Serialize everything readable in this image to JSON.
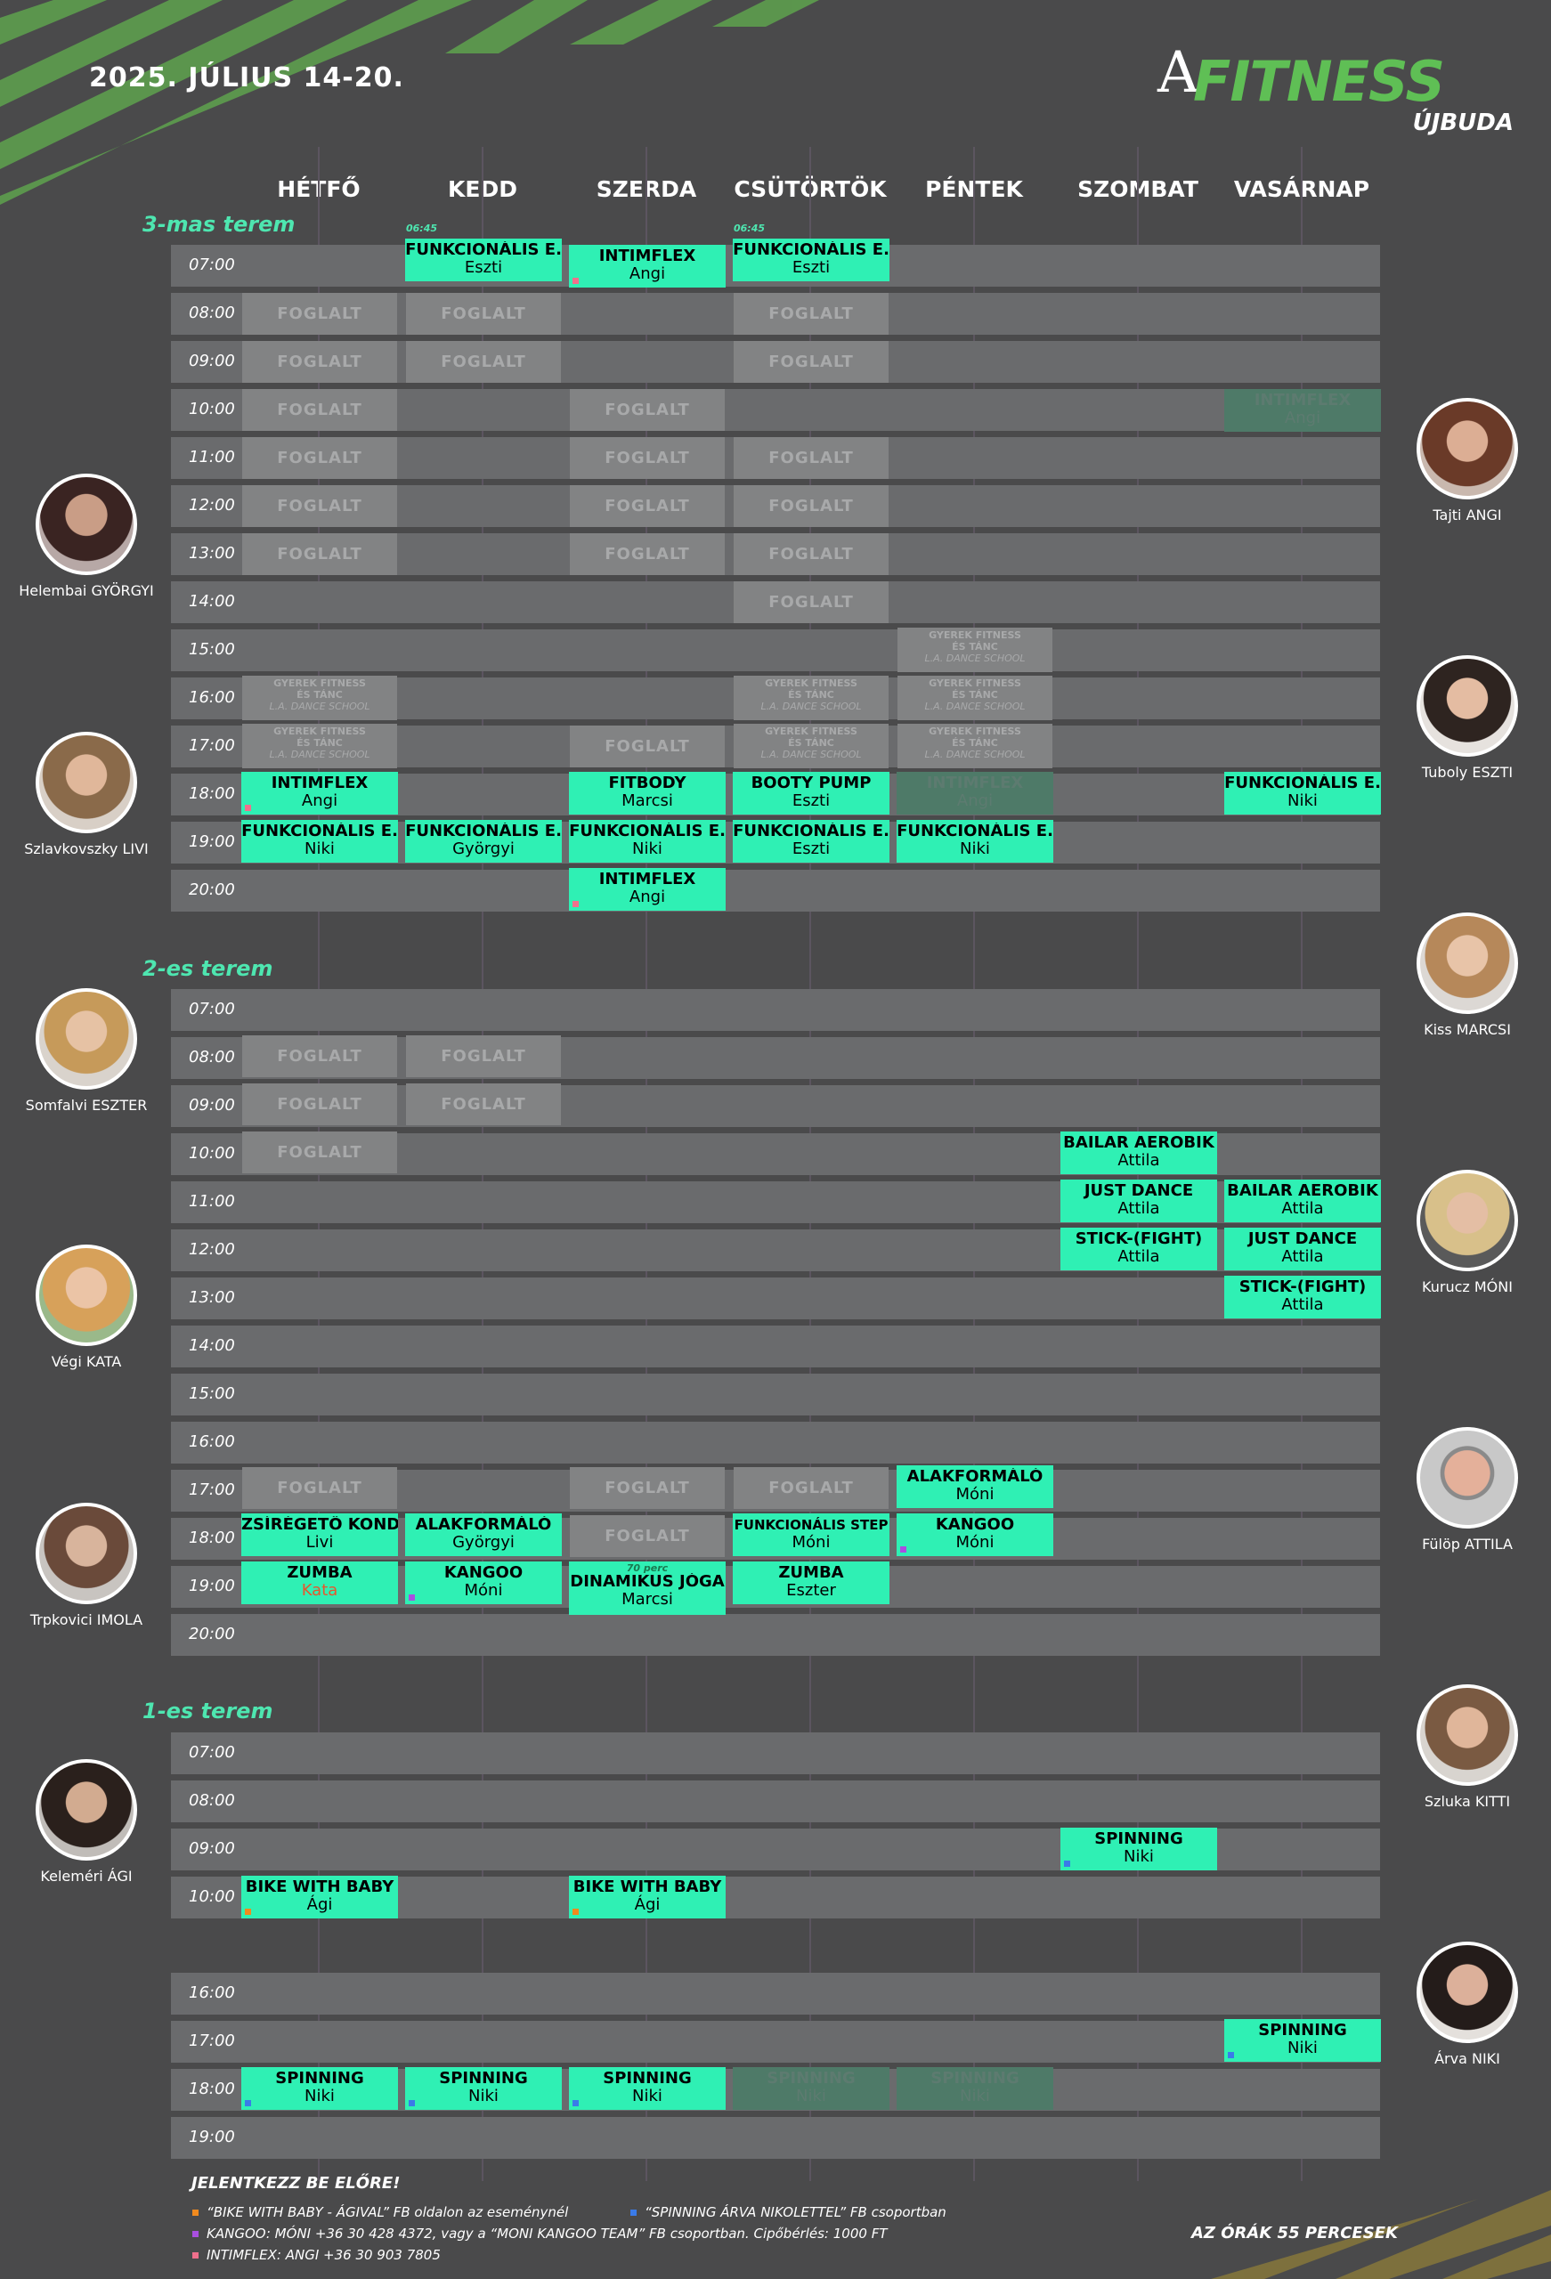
{
  "header": {
    "date": "2025. JÚLIUS 14-20.",
    "logo_a": "A",
    "logo_fitness": "FITNESS",
    "logo_location": "ÚJBUDA"
  },
  "days": [
    "HÉTFŐ",
    "KEDD",
    "SZERDA",
    "CSÜTÖRTÖK",
    "PÉNTEK",
    "SZOMBAT",
    "VASÁRNAP"
  ],
  "sections": [
    {
      "title": "3-mas terem",
      "times": [
        "07:00",
        "08:00",
        "09:00",
        "10:00",
        "11:00",
        "12:00",
        "13:00",
        "14:00",
        "15:00",
        "16:00",
        "17:00",
        "18:00",
        "19:00",
        "20:00"
      ]
    },
    {
      "title": "2-es terem",
      "times": [
        "07:00",
        "08:00",
        "09:00",
        "10:00",
        "11:00",
        "12:00",
        "13:00",
        "14:00",
        "15:00",
        "16:00",
        "17:00",
        "18:00",
        "19:00",
        "20:00"
      ]
    },
    {
      "title": "1-es terem",
      "times_a": [
        "07:00",
        "08:00",
        "09:00",
        "10:00"
      ],
      "times_b": [
        "16:00",
        "17:00",
        "18:00",
        "19:00"
      ]
    }
  ],
  "labels": {
    "foglalt": "FOGLALT",
    "gyerek_1": "GYEREK FITNESS",
    "gyerek_2": "ÉS TÁNC",
    "gyerek_3": "L.A. DANCE SCHOOL",
    "early": "06:45",
    "perc70": "70 perc"
  },
  "classes": {
    "t3_kedd_07": {
      "name": "FUNKCIONÁLIS E.",
      "instructor": "Eszti"
    },
    "t3_szerda_07": {
      "name": "INTIMFLEX",
      "instructor": "Angi"
    },
    "t3_csut_07": {
      "name": "FUNKCIONÁLIS E.",
      "instructor": "Eszti"
    },
    "t3_vas_10": {
      "name": "INTIMFLEX",
      "instructor": "Angi"
    },
    "t3_het_18": {
      "name": "INTIMFLEX",
      "instructor": "Angi"
    },
    "t3_sze_18": {
      "name": "FITBODY",
      "instructor": "Marcsi"
    },
    "t3_csu_18": {
      "name": "BOOTY PUMP",
      "instructor": "Eszti"
    },
    "t3_pen_18": {
      "name": "INTIMFLEX",
      "instructor": "Angi"
    },
    "t3_vas_18": {
      "name": "FUNKCIONÁLIS E.",
      "instructor": "Niki"
    },
    "t3_het_19": {
      "name": "FUNKCIONÁLIS E.",
      "instructor": "Niki"
    },
    "t3_ked_19": {
      "name": "FUNKCIONÁLIS E.",
      "instructor": "Györgyi"
    },
    "t3_sze_19": {
      "name": "FUNKCIONÁLIS E.",
      "instructor": "Niki"
    },
    "t3_csu_19": {
      "name": "FUNKCIONÁLIS E.",
      "instructor": "Eszti"
    },
    "t3_pen_19": {
      "name": "FUNKCIONÁLIS E.",
      "instructor": "Niki"
    },
    "t3_sze_20": {
      "name": "INTIMFLEX",
      "instructor": "Angi"
    },
    "t2_szo_10": {
      "name": "BAILAR AEROBIK",
      "instructor": "Attila"
    },
    "t2_szo_11": {
      "name": "JUST DANCE",
      "instructor": "Attila"
    },
    "t2_vas_11": {
      "name": "BAILAR AEROBIK",
      "instructor": "Attila"
    },
    "t2_szo_12": {
      "name": "STICK-(FIGHT)",
      "instructor": "Attila"
    },
    "t2_vas_12": {
      "name": "JUST DANCE",
      "instructor": "Attila"
    },
    "t2_vas_13": {
      "name": "STICK-(FIGHT)",
      "instructor": "Attila"
    },
    "t2_pen_17": {
      "name": "ALAKFORMÁLÓ",
      "instructor": "Móni"
    },
    "t2_het_18": {
      "name": "ZSÍRÉGETŐ KONDI",
      "instructor": "Livi"
    },
    "t2_ked_18": {
      "name": "ALAKFORMÁLÓ",
      "instructor": "Györgyi"
    },
    "t2_csu_18": {
      "name": "FUNKCIONÁLIS STEP",
      "instructor": "Móni"
    },
    "t2_pen_18": {
      "name": "KANGOO",
      "instructor": "Móni"
    },
    "t2_het_19": {
      "name": "ZUMBA",
      "instructor": "Kata"
    },
    "t2_ked_19": {
      "name": "KANGOO",
      "instructor": "Móni"
    },
    "t2_sze_19": {
      "name": "DINAMIKUS JÓGA",
      "instructor": "Marcsi"
    },
    "t2_csu_19": {
      "name": "ZUMBA",
      "instructor": "Eszter"
    },
    "t1_szo_09": {
      "name": "SPINNING",
      "instructor": "Niki"
    },
    "t1_het_10": {
      "name": "BIKE WITH BABY",
      "instructor": "Ági"
    },
    "t1_sze_10": {
      "name": "BIKE WITH BABY",
      "instructor": "Ági"
    },
    "t1_vas_17": {
      "name": "SPINNING",
      "instructor": "Niki"
    },
    "t1_het_18": {
      "name": "SPINNING",
      "instructor": "Niki"
    },
    "t1_ked_18": {
      "name": "SPINNING",
      "instructor": "Niki"
    },
    "t1_sze_18": {
      "name": "SPINNING",
      "instructor": "Niki"
    },
    "t1_csu_18": {
      "name": "SPINNING",
      "instructor": "Niki"
    },
    "t1_pen_18": {
      "name": "SPINNING",
      "instructor": "Niki"
    }
  },
  "trainers_left": [
    "Helembai GYÖRGYI",
    "Szlavkovszky LIVI",
    "Somfalvi ESZTER",
    "Végi KATA",
    "Trpkovici IMOLA",
    "Keleméri ÁGI"
  ],
  "trainers_right": [
    "Tajti ANGI",
    "Tuboly ESZTI",
    "Kiss MARCSI",
    "Kurucz MÓNI",
    "Fülöp ATTILA",
    "Szluka KITTI",
    "Árva NIKI"
  ],
  "footer": {
    "signup": "JELENTKEZZ BE ELŐRE!",
    "legend_bike": "“BIKE WITH BABY - ÁGIVAL” FB oldalon az eseménynél",
    "legend_spinning": "“SPINNING ÁRVA NIKOLETTEL” FB csoportban",
    "legend_kangoo": "KANGOO: MÓNI +36 30 428 4372, vagy a “MONI KANGOO TEAM” FB csoportban. Cipőbérlés: 1000 FT",
    "legend_intimflex": "INTIMFLEX: ANGI +36 30 903 7805",
    "duration_note": "AZ ÓRÁK 55 PERCESEK"
  },
  "colors": {
    "accent": "#2ff0b4",
    "bike_dot": "#f08a1e",
    "spinning_dot": "#3a7be8",
    "kangoo_dot": "#a94fe0",
    "intimflex_dot": "#f0708c"
  }
}
